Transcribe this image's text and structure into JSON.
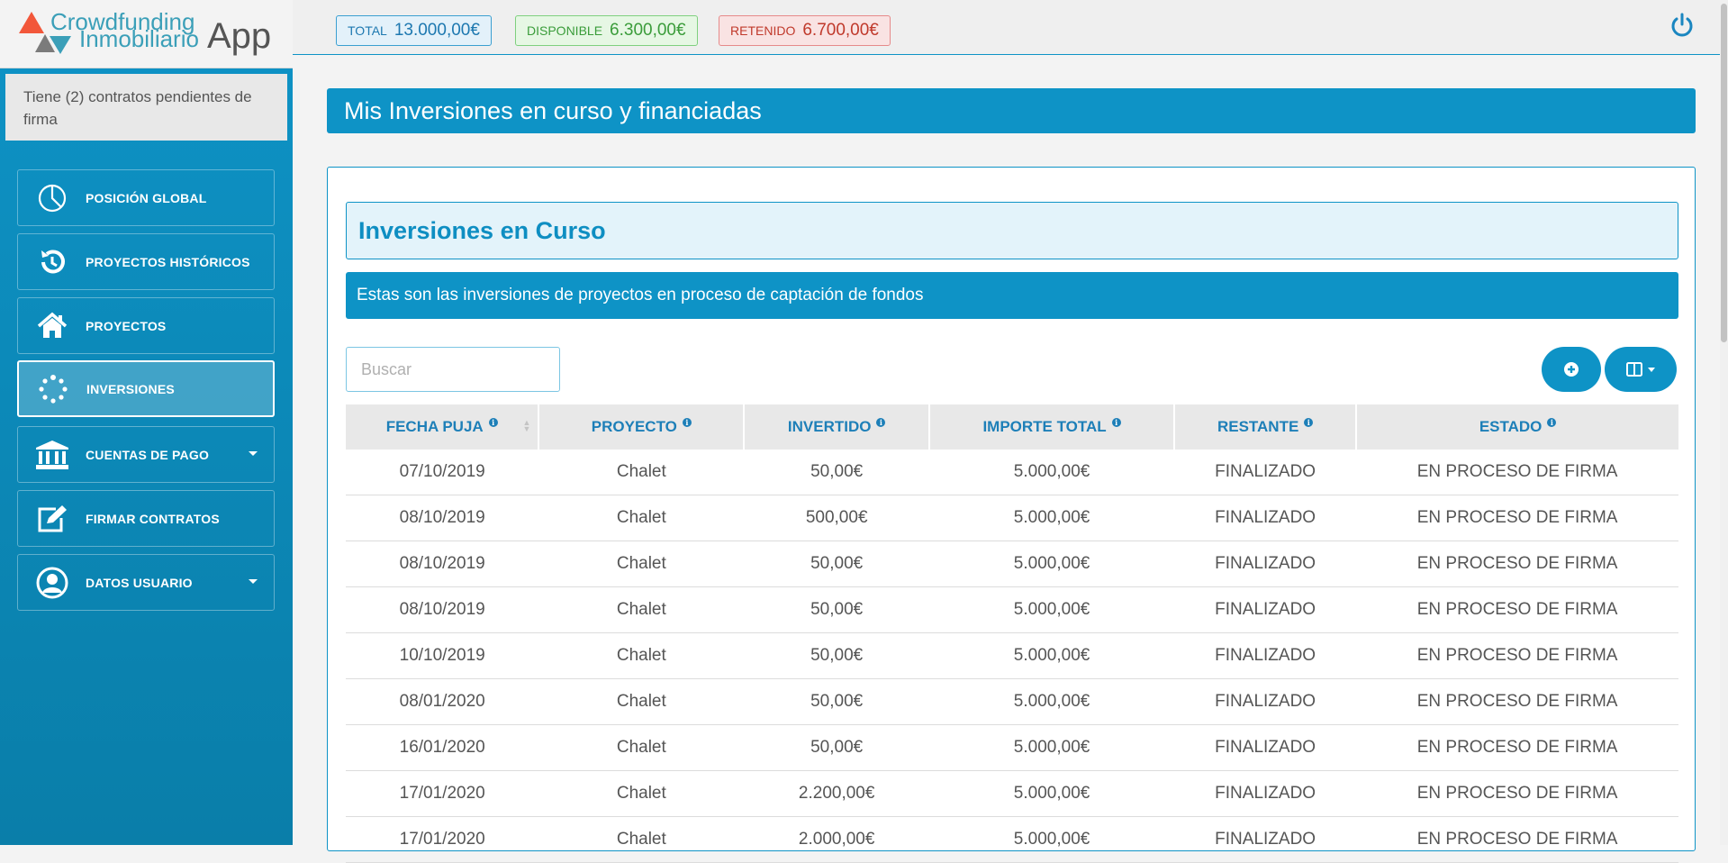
{
  "brand": {
    "line1": "Crowdfunding",
    "line2": "Inmobiliario",
    "app": "App"
  },
  "sidebar": {
    "pending_notice": "Tiene (2) contratos pendientes de firma",
    "items": [
      {
        "label": "POSICIÓN GLOBAL",
        "icon": "pie-chart-icon"
      },
      {
        "label": "PROYECTOS HISTÓRICOS",
        "icon": "history-icon"
      },
      {
        "label": "PROYECTOS",
        "icon": "home-icon"
      },
      {
        "label": "INVERSIONES",
        "icon": "spinner-icon",
        "active": true
      },
      {
        "label": "CUENTAS DE PAGO",
        "icon": "bank-icon",
        "dropdown": true
      },
      {
        "label": "FIRMAR CONTRATOS",
        "icon": "edit-icon"
      },
      {
        "label": "DATOS USUARIO",
        "icon": "user-circle-icon",
        "dropdown": true
      }
    ]
  },
  "topbar": {
    "total": {
      "label": "TOTAL",
      "value": "13.000,00€"
    },
    "disponible": {
      "label": "DISPONIBLE",
      "value": "6.300,00€"
    },
    "retenido": {
      "label": "RETENIDO",
      "value": "6.700,00€"
    },
    "power_icon": "power-icon"
  },
  "main": {
    "title": "Mis Inversiones en curso y financiadas",
    "section_title": "Inversiones en Curso",
    "section_subtitle": "Estas son las inversiones de proyectos en proceso de captación de fondos",
    "search_placeholder": "Buscar",
    "table": {
      "headers": [
        "FECHA PUJA",
        "PROYECTO",
        "INVERTIDO",
        "IMPORTE TOTAL",
        "RESTANTE",
        "ESTADO"
      ],
      "rows": [
        [
          "07/10/2019",
          "Chalet",
          "50,00€",
          "5.000,00€",
          "FINALIZADO",
          "EN PROCESO DE FIRMA"
        ],
        [
          "08/10/2019",
          "Chalet",
          "500,00€",
          "5.000,00€",
          "FINALIZADO",
          "EN PROCESO DE FIRMA"
        ],
        [
          "08/10/2019",
          "Chalet",
          "50,00€",
          "5.000,00€",
          "FINALIZADO",
          "EN PROCESO DE FIRMA"
        ],
        [
          "08/10/2019",
          "Chalet",
          "50,00€",
          "5.000,00€",
          "FINALIZADO",
          "EN PROCESO DE FIRMA"
        ],
        [
          "10/10/2019",
          "Chalet",
          "50,00€",
          "5.000,00€",
          "FINALIZADO",
          "EN PROCESO DE FIRMA"
        ],
        [
          "08/01/2020",
          "Chalet",
          "50,00€",
          "5.000,00€",
          "FINALIZADO",
          "EN PROCESO DE FIRMA"
        ],
        [
          "16/01/2020",
          "Chalet",
          "50,00€",
          "5.000,00€",
          "FINALIZADO",
          "EN PROCESO DE FIRMA"
        ],
        [
          "17/01/2020",
          "Chalet",
          "2.200,00€",
          "5.000,00€",
          "FINALIZADO",
          "EN PROCESO DE FIRMA"
        ],
        [
          "17/01/2020",
          "Chalet",
          "2.000,00€",
          "5.000,00€",
          "FINALIZADO",
          "EN PROCESO DE FIRMA"
        ]
      ]
    }
  },
  "colors": {
    "primary": "#0e93c6",
    "accent": "#f2573a",
    "success": "#3a9c3a",
    "danger": "#c0392b"
  }
}
